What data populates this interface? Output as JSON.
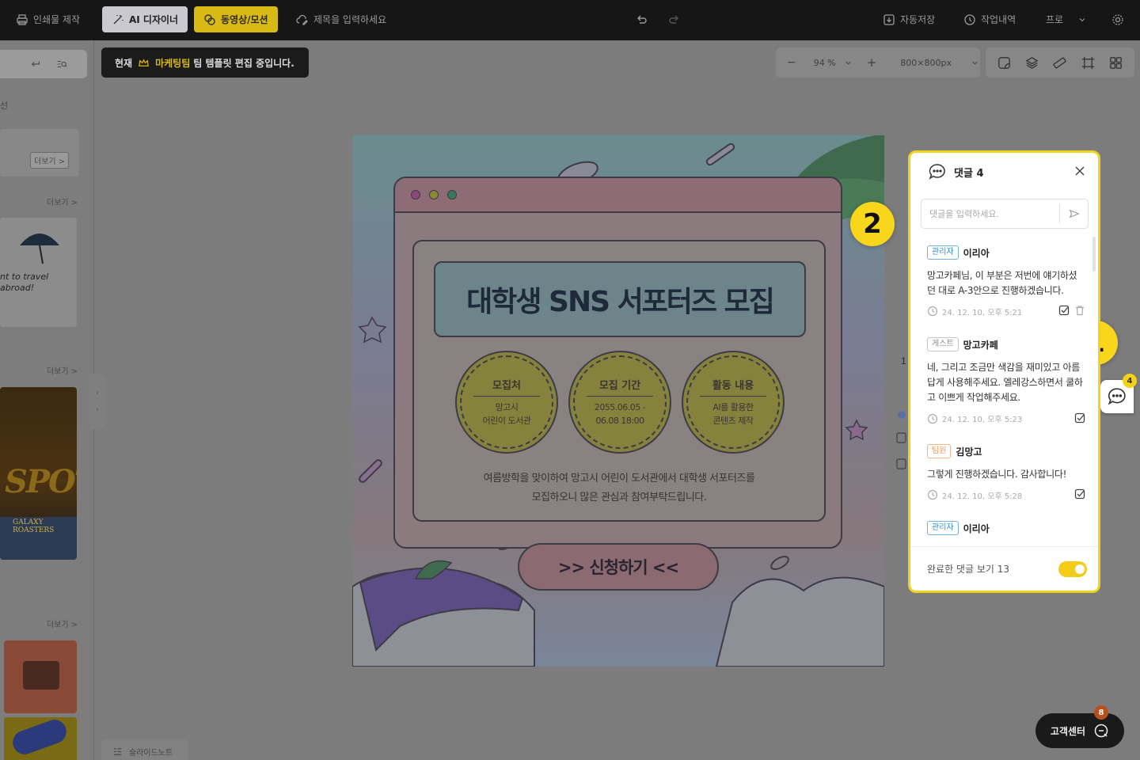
{
  "topbar": {
    "print_label": "인쇄물 제작",
    "ai_label": "AI 디자이너",
    "video_label": "동영상/모션",
    "title_placeholder": "제목을 입력하세요",
    "autosave_label": "자동저장",
    "history_label": "작업내역",
    "plan_label": "프로"
  },
  "sidebar": {
    "section_tail": "선",
    "more_label": "더보기 >",
    "thumb_travel": "nt to travel abroad!",
    "thumb_spot": "SPOT",
    "thumb_roasters": "GALAXY ROASTERS"
  },
  "notice": {
    "prefix": "현재",
    "highlight": "마케팅팀",
    "suffix": "팀 템플릿 편집 중입니다."
  },
  "zoom": {
    "value": "94 %",
    "size": "800×800px"
  },
  "design": {
    "title": "대학생 SNS 서포터즈 모집",
    "circles": [
      {
        "title": "모집처",
        "value1": "망고시",
        "value2": "어린이 도서관"
      },
      {
        "title": "모집 기간",
        "value1": "2055.06.05 -",
        "value2": "06.08 18:00"
      },
      {
        "title": "활동 내용",
        "value1": "AI를 활용한",
        "value2": "콘텐츠 제작"
      }
    ],
    "desc1": "여름방학을 맞이하여 망고시 어린이 도서관에서 대학생 서포터즈를",
    "desc2": "모집하오니 많은 관심과 참여부탁드립니다.",
    "cta": ">> 신청하기 <<"
  },
  "comments": {
    "header": "댓글 4",
    "input_placeholder": "댓글을 입력하세요.",
    "items": [
      {
        "role": "관리자",
        "name": "이리아",
        "text": "망고카페님, 이 부분은 저번에 얘기하셨던 대로 A-3안으로 진행하겠습니다.",
        "time": "24. 12. 10, 오후 5:21"
      },
      {
        "role": "게스트",
        "name": "망고카페",
        "text": "네, 그리고 조금만 색감을 재미있고 아름답게 사용해주세요. 엘레강스하면서 쿨하고 이쁘게 작업해주세요.",
        "time": "24. 12. 10, 오후 5:23"
      },
      {
        "role": "팀원",
        "name": "김망고",
        "text": "그렇게 진행하겠습니다. 감사합니다!",
        "time": "24. 12. 10, 오후 5:28"
      },
      {
        "role": "관리자",
        "name": "이리아"
      }
    ],
    "footer_label": "완료한 댓글 보기 13"
  },
  "chat_fab_badge": "4",
  "badges": {
    "one": "1",
    "two": "2"
  },
  "help": {
    "label": "고객센터",
    "badge": "8"
  },
  "slidenote_label": "슬라이드노트",
  "colors": {
    "accent": "#F2D31B",
    "topbar": "#161616",
    "admin": "#2A8FD6",
    "team": "#F29A5A"
  }
}
